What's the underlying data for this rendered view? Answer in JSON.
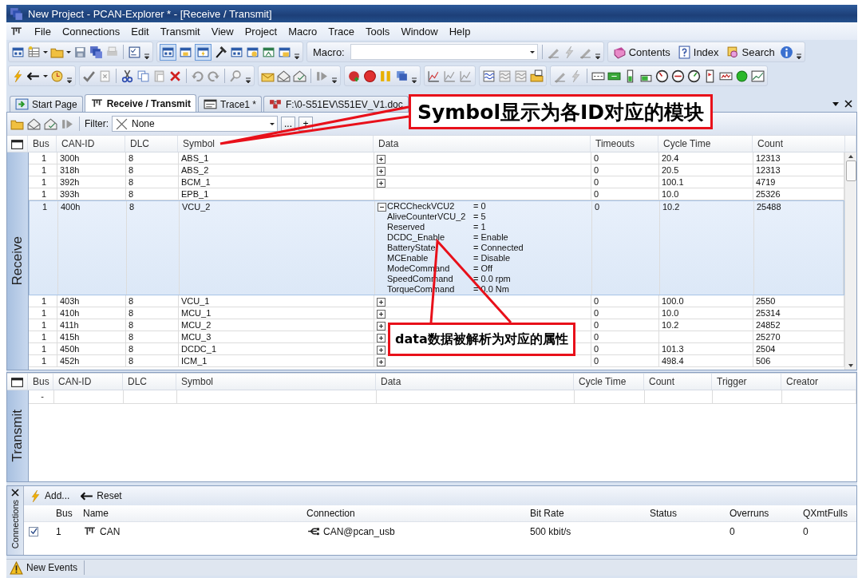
{
  "window": {
    "title": "New Project - PCAN-Explorer * - [Receive / Transmit]"
  },
  "menu": [
    {
      "label": "File"
    },
    {
      "label": "Connections"
    },
    {
      "label": "Edit"
    },
    {
      "label": "Transmit"
    },
    {
      "label": "View"
    },
    {
      "label": "Project"
    },
    {
      "label": "Macro"
    },
    {
      "label": "Trace"
    },
    {
      "label": "Tools"
    },
    {
      "label": "Window"
    },
    {
      "label": "Help"
    }
  ],
  "macro": {
    "label": "Macro:"
  },
  "help_toolbar": [
    {
      "label": "Contents"
    },
    {
      "label": "Index"
    },
    {
      "label": "Search"
    }
  ],
  "tabs": [
    {
      "label": "Start Page",
      "selected": false
    },
    {
      "label": "Receive / Transmit",
      "selected": true
    },
    {
      "label": "Trace1 *",
      "selected": false
    },
    {
      "label": "F:\\0-S51EV\\S51EV_V1.doc",
      "selected": false
    }
  ],
  "receive": {
    "side_label": "Receive",
    "filter_label": "Filter:",
    "filter_value": "None",
    "filter_buttons": [
      "...",
      "+"
    ],
    "columns": [
      "Bus",
      "CAN-ID",
      "DLC",
      "Symbol",
      "Data",
      "Timeouts",
      "Cycle Time",
      "Count"
    ],
    "rows": [
      {
        "bus": "1",
        "can_id": "300h",
        "dlc": "8",
        "symbol": "ABS_1",
        "expanded": false,
        "timeouts": "0",
        "cycle_time": "20.4",
        "count": "12313"
      },
      {
        "bus": "1",
        "can_id": "318h",
        "dlc": "8",
        "symbol": "ABS_2",
        "expanded": false,
        "timeouts": "0",
        "cycle_time": "20.5",
        "count": "12313"
      },
      {
        "bus": "1",
        "can_id": "392h",
        "dlc": "8",
        "symbol": "BCM_1",
        "expanded": false,
        "timeouts": "0",
        "cycle_time": "100.1",
        "count": "4719"
      },
      {
        "bus": "1",
        "can_id": "393h",
        "dlc": "8",
        "symbol": "EPB_1",
        "timeouts": "0",
        "cycle_time": "10.0",
        "count": "25326"
      },
      {
        "bus": "1",
        "can_id": "400h",
        "dlc": "8",
        "symbol": "VCU_2",
        "expanded": true,
        "signals": [
          {
            "name": "CRCCheckVCU2",
            "value": "= 0"
          },
          {
            "name": "AliveCounterVCU_2",
            "value": "= 5"
          },
          {
            "name": "Reserved",
            "value": "= 1"
          },
          {
            "name": "DCDC_Enable",
            "value": "= Enable"
          },
          {
            "name": "BatteryState",
            "value": "= Connected"
          },
          {
            "name": "MCEnable",
            "value": "= Disable"
          },
          {
            "name": "ModeCommand",
            "value": "= Off"
          },
          {
            "name": "SpeedCommand",
            "value": "= 0.0 rpm"
          },
          {
            "name": "TorqueCommand",
            "value": "= 0.0 Nm"
          }
        ],
        "timeouts": "0",
        "cycle_time": "10.2",
        "count": "25488"
      },
      {
        "bus": "1",
        "can_id": "403h",
        "dlc": "8",
        "symbol": "VCU_1",
        "expanded": false,
        "timeouts": "0",
        "cycle_time": "100.0",
        "count": "2550"
      },
      {
        "bus": "1",
        "can_id": "410h",
        "dlc": "8",
        "symbol": "MCU_1",
        "expanded": false,
        "timeouts": "0",
        "cycle_time": "10.0",
        "count": "25314"
      },
      {
        "bus": "1",
        "can_id": "411h",
        "dlc": "8",
        "symbol": "MCU_2",
        "expanded": false,
        "timeouts": "0",
        "cycle_time": "10.2",
        "count": "24852"
      },
      {
        "bus": "1",
        "can_id": "415h",
        "dlc": "8",
        "symbol": "MCU_3",
        "expanded": false,
        "timeouts": "0",
        "count": "25270"
      },
      {
        "bus": "1",
        "can_id": "450h",
        "dlc": "8",
        "symbol": "DCDC_1",
        "expanded": false,
        "timeouts": "0",
        "cycle_time": "101.3",
        "count": "2504"
      },
      {
        "bus": "1",
        "can_id": "452h",
        "dlc": "8",
        "symbol": "ICM_1",
        "expanded": false,
        "timeouts": "0",
        "cycle_time": "498.4",
        "count": "506"
      }
    ]
  },
  "transmit": {
    "side_label": "Transmit",
    "columns": [
      "Bus",
      "CAN-ID",
      "DLC",
      "Symbol",
      "Data",
      "Cycle Time",
      "Count",
      "Trigger",
      "Creator"
    ],
    "rows": [
      {
        "bus": "-"
      }
    ]
  },
  "connections": {
    "side_label": "Connections",
    "actions": [
      {
        "kind": "add",
        "label": "Add..."
      },
      {
        "kind": "reset",
        "label": "Reset"
      }
    ],
    "columns": [
      "Bus",
      "Name",
      "Connection",
      "Bit Rate",
      "Status",
      "Overruns",
      "QXmtFulls"
    ],
    "rows": [
      {
        "checked": true,
        "bus": "1",
        "name": "CAN",
        "connection": "CAN@pcan_usb",
        "bit_rate": "500 kbit/s",
        "overruns": "0",
        "qxmtfulls": "0"
      }
    ]
  },
  "status_bar": {
    "label": "New Events"
  },
  "callouts": [
    {
      "text": "Symbol显示为各ID对应的模块"
    },
    {
      "text": "data数据被解析为对应的属性"
    }
  ]
}
